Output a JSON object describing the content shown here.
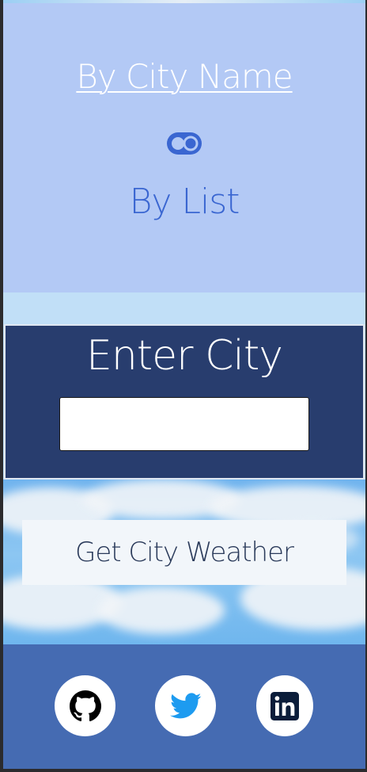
{
  "mode_switch": {
    "by_city_name_label": "By City Name",
    "by_list_label": "By List",
    "toggle_icon": "toggle-switch-icon"
  },
  "enter_city": {
    "title": "Enter City",
    "input_value": ""
  },
  "actions": {
    "get_weather_label": "Get City Weather"
  },
  "footer": {
    "links": [
      {
        "icon": "github-icon"
      },
      {
        "icon": "twitter-icon"
      },
      {
        "icon": "linkedin-icon"
      }
    ]
  },
  "colors": {
    "mode_panel_bg": "#b3c9f5",
    "accent_blue": "#3a66d1",
    "enter_panel_bg": "#283d6e",
    "footer_bg": "#456bb2"
  }
}
